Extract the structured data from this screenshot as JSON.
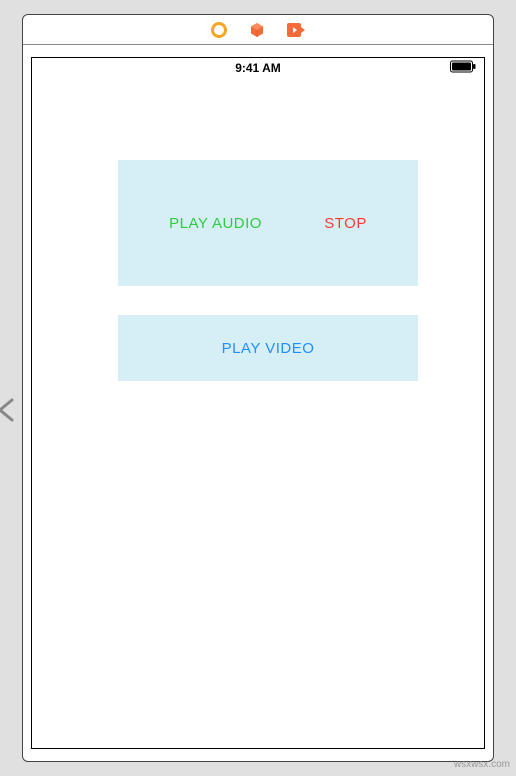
{
  "status_bar": {
    "time": "9:41 AM"
  },
  "panels": {
    "play_audio_label": "PLAY AUDIO",
    "stop_label": "STOP",
    "play_video_label": "PLAY VIDEO"
  },
  "watermark": "wsxwsx.com",
  "icons": {
    "circle": "record-icon",
    "cube": "object-icon",
    "embed": "embed-icon"
  }
}
